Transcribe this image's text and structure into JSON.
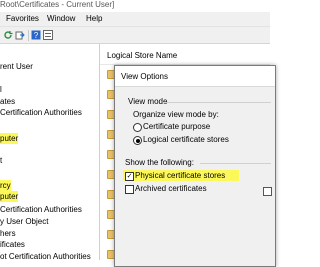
{
  "window": {
    "title": "Root\\Certificates - Current User]"
  },
  "menu": {
    "items": [
      "Favorites",
      "Window",
      "Help"
    ]
  },
  "toolbar": {
    "icons": [
      "refresh-icon",
      "export-icon",
      "help-icon",
      "properties-icon"
    ]
  },
  "tree": {
    "items": [
      {
        "label": "rent User",
        "highlight": false
      },
      {
        "label": "l",
        "highlight": false
      },
      {
        "label": "ates",
        "highlight": false
      },
      {
        "label": "Certification Authorities",
        "highlight": false
      },
      {
        "label": "puter",
        "highlight": true
      },
      {
        "label": "t",
        "highlight": false
      },
      {
        "label": "rcy",
        "highlight": true
      },
      {
        "label": "puter",
        "highlight": true
      },
      {
        "label": "Certification Authorities",
        "highlight": false
      },
      {
        "label": "y User Object",
        "highlight": false
      },
      {
        "label": "hers",
        "highlight": false
      },
      {
        "label": "ificates",
        "highlight": false
      },
      {
        "label": "ot Certification Authorities",
        "highlight": false
      }
    ]
  },
  "list": {
    "header": "Logical Store Name"
  },
  "dialog": {
    "title": "View Options",
    "view_mode_label": "View mode",
    "organize_label": "Organize view mode by:",
    "radio_purpose": "Certificate purpose",
    "radio_logical": "Logical certificate stores",
    "show_label": "Show the following:",
    "check_physical": "Physical certificate stores",
    "check_archived": "Archived certificates",
    "physical_checked": true,
    "archived_checked": false,
    "selected_mode": "logical"
  },
  "colors": {
    "highlight": "#fdf85a",
    "folder": "#e8c26b"
  }
}
